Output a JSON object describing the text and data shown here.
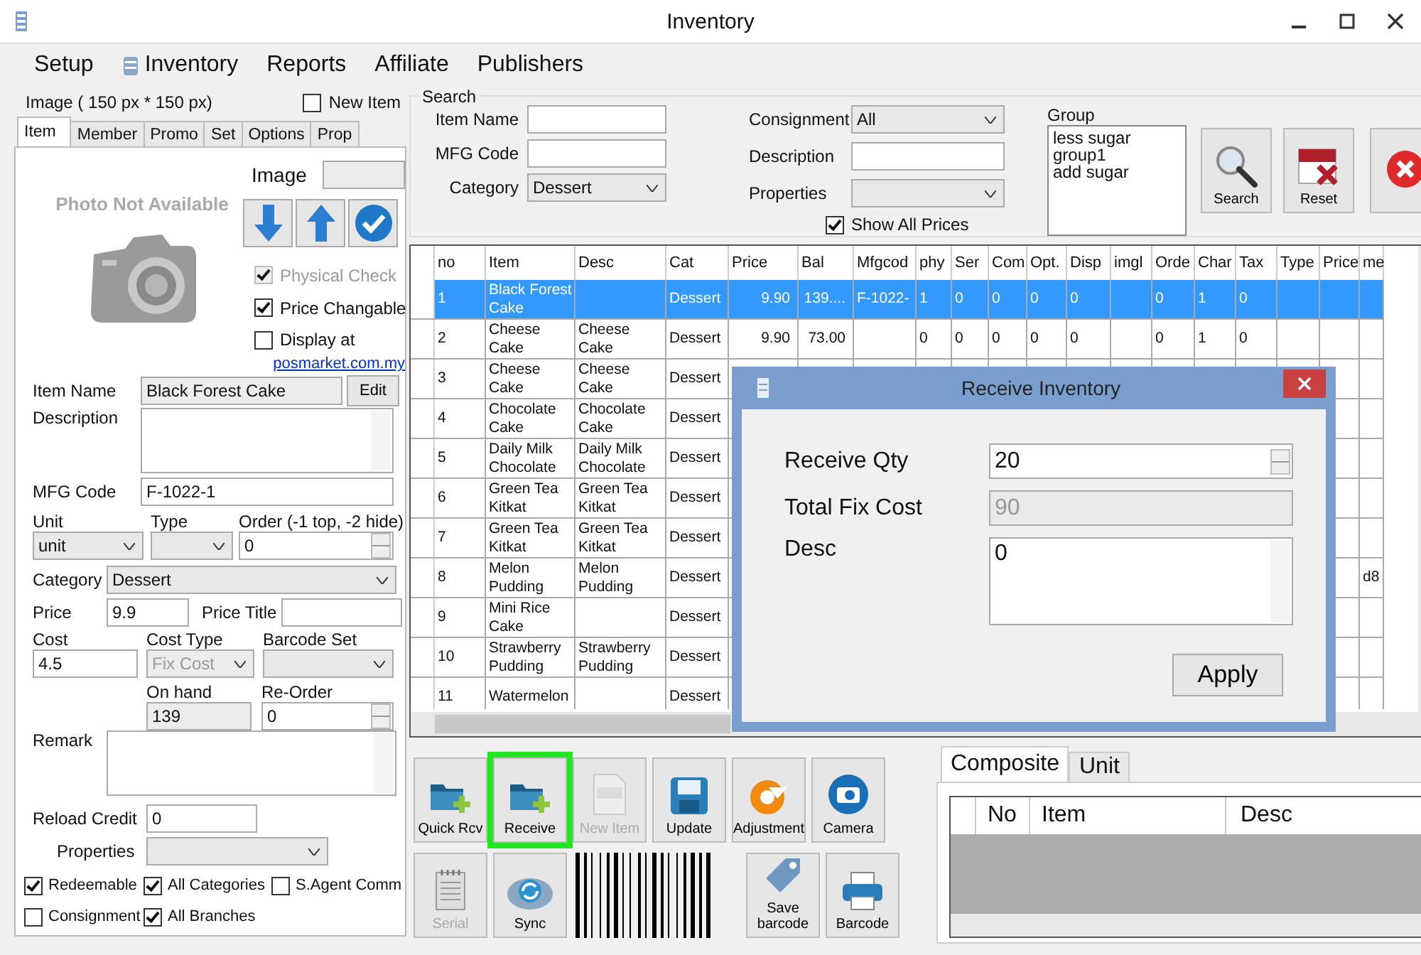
{
  "window": {
    "title": "Inventory"
  },
  "menu": [
    {
      "label": "Setup",
      "has_icon": false
    },
    {
      "label": "Inventory",
      "has_icon": true
    },
    {
      "label": "Reports",
      "has_icon": false
    },
    {
      "label": "Affiliate",
      "has_icon": false
    },
    {
      "label": "Publishers",
      "has_icon": false
    }
  ],
  "item_panel": {
    "image_caption": "Image ( 150 px * 150 px)",
    "new_item": {
      "label": "New Item",
      "checked": false
    },
    "tabs": [
      {
        "label": "Item",
        "selected": true
      },
      {
        "label": "Member",
        "selected": false
      },
      {
        "label": "Promo",
        "selected": false
      },
      {
        "label": "Set",
        "selected": false
      },
      {
        "label": "Options",
        "selected": false
      },
      {
        "label": "Prop",
        "selected": false
      }
    ],
    "photo_placeholder": "Photo Not Available",
    "image_label": "Image",
    "options": [
      {
        "label": "Physical Check",
        "checked": true,
        "disabled": true
      },
      {
        "label": "Price Changable",
        "checked": true,
        "disabled": false
      },
      {
        "label": "Display at",
        "checked": false,
        "disabled": false
      }
    ],
    "link": "posmarket.com.my",
    "item_name": {
      "label": "Item Name",
      "value": "Black Forest Cake",
      "readonly": true,
      "button": "Edit"
    },
    "description": {
      "label": "Description"
    },
    "mfg_code": {
      "label": "MFG Code",
      "value": "F-1022-1"
    },
    "unit": {
      "label": "Unit",
      "value": "unit"
    },
    "type": {
      "label": "Type"
    },
    "order": {
      "label": "Order (-1 top, -2 hide)",
      "value": "0"
    },
    "category": {
      "label": "Category",
      "value": "Dessert"
    },
    "price": {
      "label": "Price",
      "value": "9.9"
    },
    "price_title": {
      "label": "Price Title"
    },
    "cost": {
      "label": "Cost",
      "value": "4.5"
    },
    "cost_type": {
      "label": "Cost Type",
      "value": "Fix Cost",
      "disabled": true
    },
    "barcode_set": {
      "label": "Barcode Set"
    },
    "on_hand": {
      "label": "On hand",
      "value": "139",
      "readonly": true
    },
    "re_order": {
      "label": "Re-Order",
      "value": "0"
    },
    "remark": {
      "label": "Remark"
    },
    "reload_credit": {
      "label": "Reload Credit",
      "value": "0"
    },
    "properties": {
      "label": "Properties"
    },
    "flags": [
      {
        "label": "Redeemable",
        "checked": true
      },
      {
        "label": "All Categories",
        "checked": true
      },
      {
        "label": "S.Agent Comm",
        "checked": false
      },
      {
        "label": "Consignment",
        "checked": false
      },
      {
        "label": "All Branches",
        "checked": true
      }
    ]
  },
  "search": {
    "title": "Search",
    "item_name": {
      "label": "Item Name"
    },
    "mfg_code": {
      "label": "MFG Code"
    },
    "category": {
      "label": "Category",
      "value": "Dessert"
    },
    "consignment": {
      "label": "Consignment",
      "value": "All"
    },
    "description": {
      "label": "Description"
    },
    "properties": {
      "label": "Properties"
    },
    "show_all_prices": {
      "label": "Show All Prices",
      "checked": true
    },
    "group": {
      "label": "Group",
      "items": [
        "less sugar",
        "group1",
        "add sugar"
      ]
    },
    "buttons": [
      {
        "label": "Search",
        "kind": "search"
      },
      {
        "label": "Reset",
        "kind": "reset"
      },
      {
        "kind": "close"
      }
    ]
  },
  "grid": {
    "columns": [
      "no",
      "Item",
      "Desc",
      "Cat",
      "Price",
      "Bal",
      "Mfgcod",
      "phy",
      "Ser",
      "Com",
      "Opt.",
      "Disp",
      "imgl",
      "Orde",
      "Char",
      "Tax",
      "Type",
      "Price",
      "me"
    ],
    "rows": [
      {
        "selected": true,
        "no": "1",
        "item": "Black Forest Cake",
        "cat": "Dessert",
        "price": "9.90",
        "bal": "139....",
        "mfgcode": "F-1022-",
        "phy": "1",
        "ser": "0",
        "com": "0",
        "opt": "0",
        "disp": "0",
        "orde": "0",
        "char": "1",
        "tax": "0"
      },
      {
        "selected": false,
        "no": "2",
        "item": "Cheese Cake",
        "desc": "Cheese Cake",
        "cat": "Dessert",
        "price": "9.90",
        "bal": "73.00",
        "phy": "0",
        "ser": "0",
        "com": "0",
        "opt": "0",
        "disp": "0",
        "orde": "0",
        "char": "1",
        "tax": "0"
      },
      {
        "selected": false,
        "no": "3",
        "item": "Cheese Cake",
        "desc": "Cheese Cake",
        "cat": "Dessert"
      },
      {
        "selected": false,
        "no": "4",
        "item": "Chocolate Cake",
        "desc": "Chocolate Cake",
        "cat": "Dessert"
      },
      {
        "selected": false,
        "no": "5",
        "item": "Daily Milk Chocolate",
        "desc": "Daily Milk Chocolate",
        "cat": "Dessert"
      },
      {
        "selected": false,
        "no": "6",
        "item": "Green Tea Kitkat",
        "desc": "Green Tea Kitkat",
        "cat": "Dessert"
      },
      {
        "selected": false,
        "no": "7",
        "item": "Green Tea Kitkat",
        "desc": "Green Tea Kitkat",
        "cat": "Dessert"
      },
      {
        "selected": false,
        "no": "8",
        "item": "Melon Pudding",
        "desc": "Melon Pudding",
        "cat": "Dessert",
        "me": "d8"
      },
      {
        "selected": false,
        "no": "9",
        "item": "Mini Rice Cake",
        "cat": "Dessert"
      },
      {
        "selected": false,
        "no": "10",
        "item": "Strawberry Pudding",
        "desc": "Strawberry Pudding",
        "cat": "Dessert"
      },
      {
        "selected": false,
        "no": "11",
        "item": "Watermelon",
        "cat": "Dessert"
      }
    ]
  },
  "dialog": {
    "title": "Receive Inventory",
    "receive_qty": {
      "label": "Receive Qty",
      "value": "20"
    },
    "total_fix_cost": {
      "label": "Total Fix Cost",
      "value": "90",
      "disabled": true
    },
    "desc": {
      "label": "Desc",
      "value": "0"
    },
    "apply": "Apply"
  },
  "toolbar": [
    [
      {
        "label": "Quick Rcv",
        "kind": "folder",
        "disabled": false,
        "highlighted": false
      },
      {
        "label": "Receive",
        "kind": "folder",
        "disabled": false,
        "highlighted": true
      },
      {
        "label": "New Item",
        "kind": "new",
        "disabled": true,
        "highlighted": false
      },
      {
        "label": "Update",
        "kind": "save",
        "disabled": false,
        "highlighted": false
      },
      {
        "label": "Adjustment",
        "kind": "adjust",
        "disabled": false,
        "highlighted": false
      },
      {
        "label": "Camera",
        "kind": "camera",
        "disabled": false,
        "highlighted": false
      }
    ],
    [
      {
        "label": "Serial",
        "kind": "notepad",
        "disabled": true,
        "highlighted": false
      },
      {
        "label": "Sync",
        "kind": "sync",
        "disabled": false,
        "highlighted": false
      },
      {
        "kind": "barcode"
      },
      {
        "label": "Save barcode",
        "kind": "tag",
        "disabled": false,
        "highlighted": false
      },
      {
        "label": "Barcode",
        "kind": "printer",
        "disabled": false,
        "highlighted": false
      }
    ]
  ],
  "composite": {
    "tabs": [
      {
        "label": "Composite",
        "selected": true
      },
      {
        "label": "Unit",
        "selected": false
      }
    ],
    "columns": [
      "No",
      "Item",
      "Desc"
    ]
  }
}
